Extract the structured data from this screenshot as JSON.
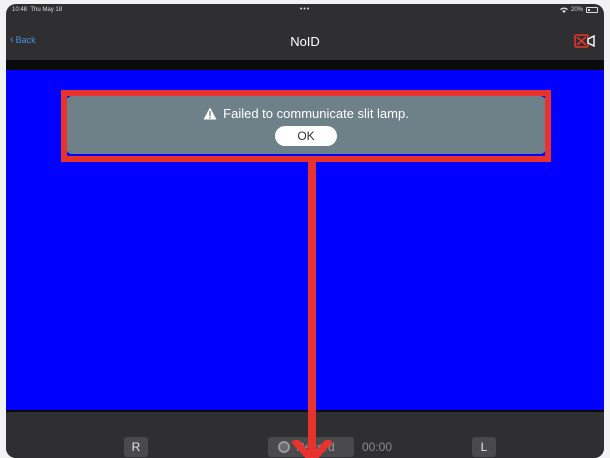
{
  "status_bar": {
    "time": "10:48",
    "date": "Thu May 18",
    "battery": "20%",
    "dots": "•••"
  },
  "nav": {
    "back_label": "Back",
    "title": "NoID",
    "camera_icon": "camera-off-icon"
  },
  "alert": {
    "message": "Failed to communicate slit lamp.",
    "ok_label": "OK",
    "icon": "warning-icon"
  },
  "toolbar": {
    "right_label": "R",
    "left_label": "L",
    "record_label": "Record",
    "timer": "00:00"
  },
  "colors": {
    "video_bg": "#0000ff",
    "annotation": "#e8322e",
    "alert_bg": "#6e8088",
    "accent": "#4a90e2"
  }
}
